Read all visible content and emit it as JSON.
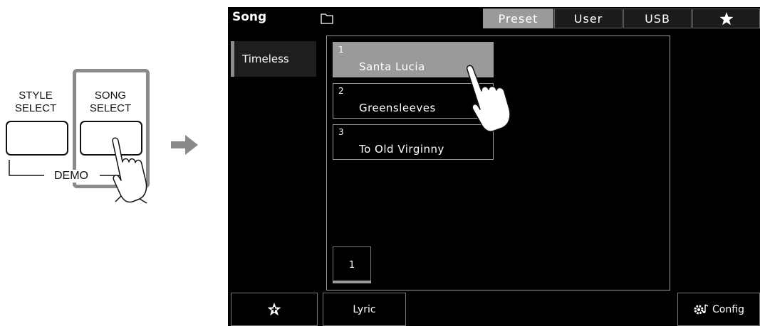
{
  "panel": {
    "style_select_line1": "STYLE",
    "style_select_line2": "SELECT",
    "song_select_line1": "SONG",
    "song_select_line2": "SELECT",
    "demo_label": "DEMO"
  },
  "screen": {
    "title": "Song",
    "tabs": [
      {
        "label": "Preset",
        "active": true
      },
      {
        "label": "User",
        "active": false
      },
      {
        "label": "USB",
        "active": false
      },
      {
        "label": "",
        "icon": "star-icon",
        "active": false
      }
    ],
    "category": "Timeless",
    "songs": [
      {
        "number": "1",
        "name": "Santa Lucia",
        "selected": true
      },
      {
        "number": "2",
        "name": "Greensleeves",
        "selected": false
      },
      {
        "number": "3",
        "name": "To Old Virginny",
        "selected": false
      }
    ],
    "page": "1",
    "bottom": {
      "favorite_icon": "star-plus-icon",
      "lyric_label": "Lyric",
      "config_label": "Config",
      "config_icon": "gear-note-icon"
    }
  },
  "colors": {
    "screen_bg": "#000000",
    "active_tab": "#9a9a9a",
    "selected_item": "#9a9a9a",
    "highlight_frame": "#8a8a8a",
    "arrow": "#8a8a8a"
  }
}
